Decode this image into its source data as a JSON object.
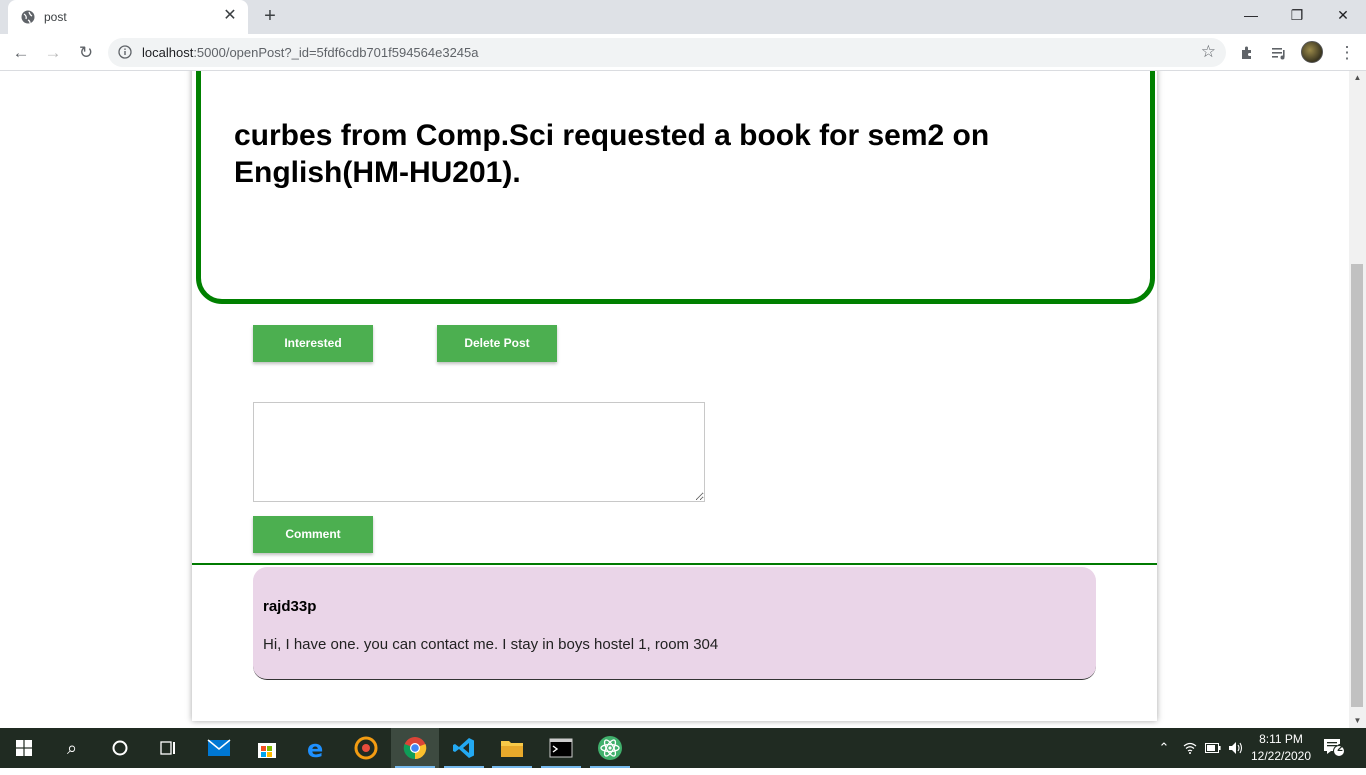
{
  "browser": {
    "tab_title": "post",
    "tab_close": "✕",
    "new_tab": "+",
    "url_host": "localhost",
    "url_rest": ":5000/openPost?_id=5fdf6cdb701f594564e3245a",
    "window_controls": {
      "minimize": "—",
      "restore": "❐",
      "close": "✕"
    }
  },
  "post": {
    "heading": "curbes from Comp.Sci requested a book for sem2 on English(HM-HU201)."
  },
  "actions": {
    "interested_label": "Interested",
    "delete_label": "Delete Post",
    "comment_label": "Comment"
  },
  "comment_input": {
    "value": "",
    "placeholder": ""
  },
  "comments": [
    {
      "user": "rajd33p",
      "text": "Hi, I have one. you can contact me. I stay in boys hostel 1, room 304"
    }
  ],
  "taskbar": {
    "time": "8:11 PM",
    "date": "12/22/2020",
    "notifications": "2"
  },
  "colors": {
    "accent_green": "#008000",
    "button_green": "#4caf50",
    "comment_bg": "#ead5e8"
  }
}
